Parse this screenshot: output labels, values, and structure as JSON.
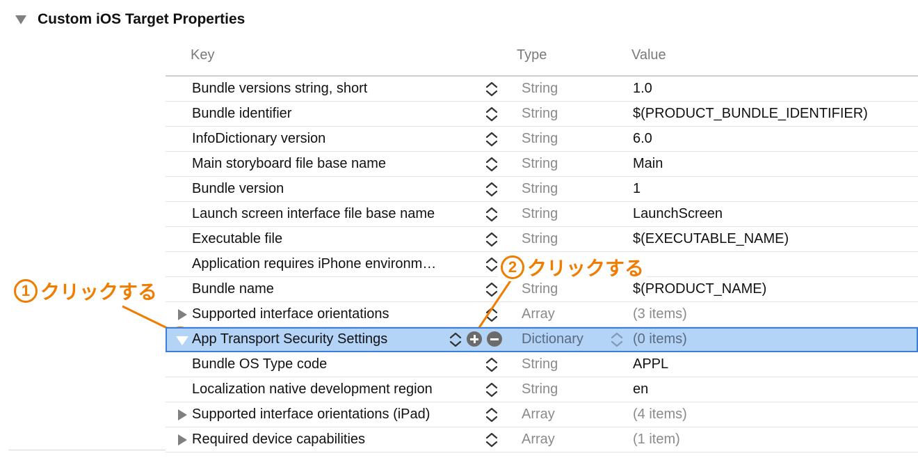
{
  "section": {
    "title": "Custom iOS Target Properties"
  },
  "columns": {
    "key": "Key",
    "type": "Type",
    "value": "Value"
  },
  "rows": [
    {
      "key": "Bundle versions string, short",
      "type": "String",
      "value": "1.0",
      "disclosure": "none"
    },
    {
      "key": "Bundle identifier",
      "type": "String",
      "value": "$(PRODUCT_BUNDLE_IDENTIFIER)",
      "disclosure": "none"
    },
    {
      "key": "InfoDictionary version",
      "type": "String",
      "value": "6.0",
      "disclosure": "none"
    },
    {
      "key": "Main storyboard file base name",
      "type": "String",
      "value": "Main",
      "disclosure": "none"
    },
    {
      "key": "Bundle version",
      "type": "String",
      "value": "1",
      "disclosure": "none"
    },
    {
      "key": "Launch screen interface file base name",
      "type": "String",
      "value": "LaunchScreen",
      "disclosure": "none"
    },
    {
      "key": "Executable file",
      "type": "String",
      "value": "$(EXECUTABLE_NAME)",
      "disclosure": "none"
    },
    {
      "key": "Application requires iPhone environm…",
      "type": "",
      "value": "",
      "disclosure": "none"
    },
    {
      "key": "Bundle name",
      "type": "String",
      "value": "$(PRODUCT_NAME)",
      "disclosure": "none"
    },
    {
      "key": "Supported interface orientations",
      "type": "Array",
      "value": "(3 items)",
      "disclosure": "collapsed"
    },
    {
      "key": "App Transport Security Settings",
      "type": "Dictionary",
      "value": "(0 items)",
      "disclosure": "expanded",
      "selected": true
    },
    {
      "key": "Bundle OS Type code",
      "type": "String",
      "value": "APPL",
      "disclosure": "none"
    },
    {
      "key": "Localization native development region",
      "type": "String",
      "value": "en",
      "disclosure": "none"
    },
    {
      "key": "Supported interface orientations (iPad)",
      "type": "Array",
      "value": "(4 items)",
      "disclosure": "collapsed"
    },
    {
      "key": "Required device capabilities",
      "type": "Array",
      "value": "(1 item)",
      "disclosure": "collapsed"
    }
  ],
  "annotations": {
    "first": {
      "number": "1",
      "text": "クリックする"
    },
    "second": {
      "number": "2",
      "text": "クリックする"
    }
  },
  "colors": {
    "accent": "#f07c00",
    "selection": "#b3d4f7",
    "selection_border": "#3b7ddb"
  }
}
